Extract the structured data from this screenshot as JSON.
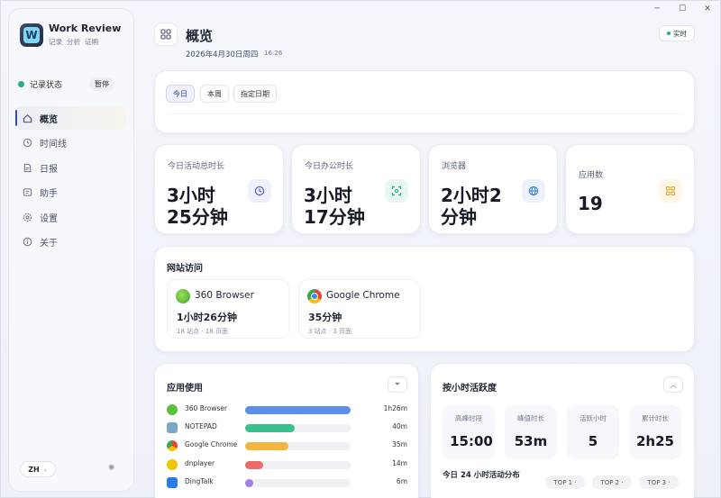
{
  "window_controls": [
    "─",
    "☐",
    "✕"
  ],
  "app": {
    "title": "Work Review",
    "subtitle_items": [
      "记录",
      "分析",
      "证明"
    ],
    "logo_letter": "W"
  },
  "record": {
    "status": "记录状态",
    "pause": "暂停"
  },
  "nav": [
    {
      "label": "概览",
      "icon": "home-icon",
      "active": true
    },
    {
      "label": "时间线",
      "icon": "clock-icon",
      "active": false
    },
    {
      "label": "日报",
      "icon": "document-icon",
      "active": false
    },
    {
      "label": "助手",
      "icon": "chat-icon",
      "active": false
    },
    {
      "label": "设置",
      "icon": "gear-icon",
      "active": false
    },
    {
      "label": "关于",
      "icon": "info-icon",
      "active": false
    }
  ],
  "lang": "ZH",
  "header": {
    "title": "概览",
    "date": "2026年4月30日周四",
    "time": "16:26",
    "realtime": "实时"
  },
  "tabs": [
    "今日",
    "本周",
    "指定日期"
  ],
  "stats": [
    {
      "label": "今日活动总时长",
      "value_line1": "3小时",
      "value_line2": "25分钟",
      "icon": "clock-icon",
      "color": "#4a5ad8"
    },
    {
      "label": "今日办公时长",
      "value_line1": "3小时",
      "value_line2": "17分钟",
      "icon": "focus-icon",
      "color": "#22b07d"
    },
    {
      "label": "浏览器",
      "value_line1": "2小时2",
      "value_line2": "分钟",
      "icon": "globe-icon",
      "color": "#3a7ad8"
    },
    {
      "label": "应用数",
      "value_line1": "19",
      "value_line2": "",
      "icon": "grid-icon",
      "color": "#e0a020"
    }
  ],
  "websites": {
    "title": "网站访问",
    "items": [
      {
        "name": "360 Browser",
        "duration": "1小时26分钟",
        "sites": "18 站点",
        "pages": "18 页面"
      },
      {
        "name": "Google Chrome",
        "duration": "35分钟",
        "sites": "3 站点",
        "pages": "3 页面"
      }
    ]
  },
  "app_usage": {
    "title": "应用使用",
    "items": [
      {
        "name": "360 Browser",
        "duration": "1h26m",
        "fraction": 1.0,
        "color": "#5b8fe8"
      },
      {
        "name": "NOTEPAD",
        "duration": "40m",
        "fraction": 0.47,
        "color": "#3cbf8f"
      },
      {
        "name": "Google Chrome",
        "duration": "35m",
        "fraction": 0.41,
        "color": "#f2b540"
      },
      {
        "name": "dnplayer",
        "duration": "14m",
        "fraction": 0.17,
        "color": "#ec6b6b"
      },
      {
        "name": "DingTalk",
        "duration": "6m",
        "fraction": 0.08,
        "color": "#a57be8"
      }
    ]
  },
  "hourly": {
    "title": "按小时活跃度",
    "metrics": [
      {
        "label": "高峰时段",
        "value": "15:00"
      },
      {
        "label": "峰值时长",
        "value": "53m"
      },
      {
        "label": "活跃小时",
        "value": "5"
      },
      {
        "label": "累计时长",
        "value": "2h25"
      }
    ],
    "distribution_title": "今日 24 小时活动分布",
    "top_chips": [
      "TOP 1 ·",
      "TOP 2 ·",
      "TOP 3 ·"
    ]
  }
}
